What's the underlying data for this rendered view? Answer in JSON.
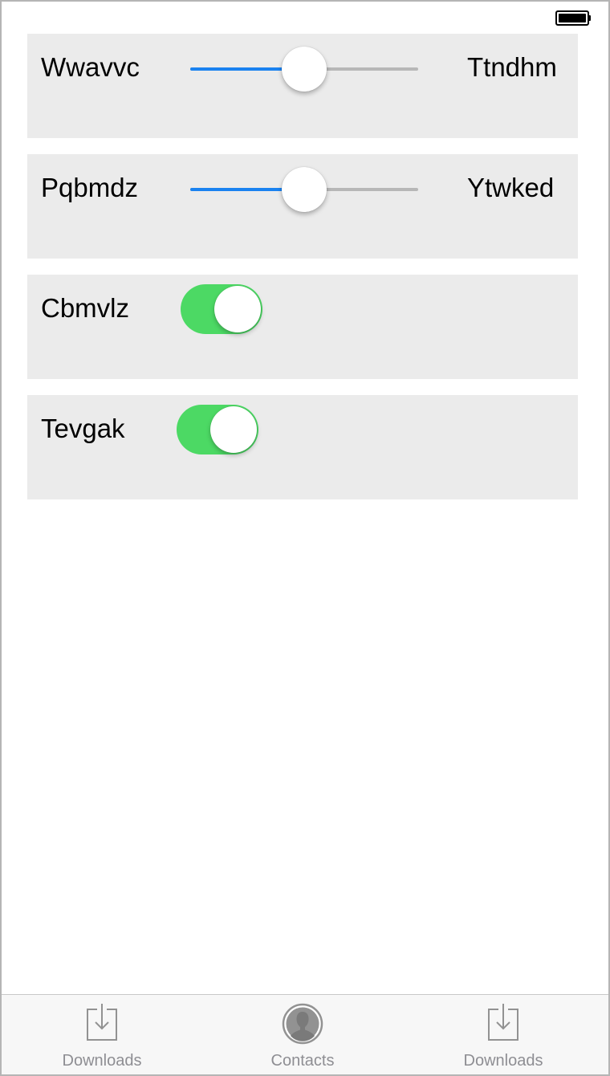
{
  "status_bar": {
    "battery_icon": "battery-full-icon"
  },
  "rows": [
    {
      "type": "slider",
      "label": "Wwavvc",
      "right_label": "Ttndhm",
      "value": 0.5
    },
    {
      "type": "slider",
      "label": "Pqbmdz",
      "right_label": "Ytwked",
      "value": 0.5
    },
    {
      "type": "toggle",
      "label": "Cbmvlz",
      "on": true
    },
    {
      "type": "toggle",
      "label": "Tevgak",
      "on": true
    }
  ],
  "tabbar": {
    "items": [
      {
        "label": "Downloads",
        "icon": "download-icon"
      },
      {
        "label": "Contacts",
        "icon": "contact-icon"
      },
      {
        "label": "Downloads",
        "icon": "download-icon"
      }
    ]
  },
  "colors": {
    "slider_fill": "#1a82f0",
    "slider_track": "#b7b7b7",
    "toggle_on": "#4cd964",
    "row_background": "#ebebeb",
    "tab_label": "#8e8e93"
  }
}
